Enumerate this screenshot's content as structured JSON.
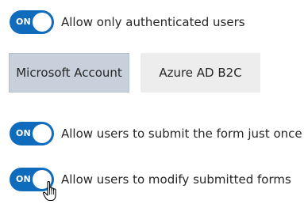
{
  "auth_setting": {
    "toggle_label": "ON",
    "label": "Allow only authenticated users",
    "enabled": true
  },
  "providers": [
    {
      "label": "Microsoft Account",
      "selected": true
    },
    {
      "label": "Azure AD B2C",
      "selected": false
    }
  ],
  "submit_once_setting": {
    "toggle_label": "ON",
    "label": "Allow users to submit the form just once",
    "enabled": true
  },
  "modify_setting": {
    "toggle_label": "ON",
    "label": "Allow users to modify submitted forms",
    "enabled": true
  },
  "colors": {
    "accent": "#0f6cbd",
    "selected_button_bg": "#c8d1db",
    "unselected_button_bg": "#ededed"
  },
  "cursor_icon": "hand-pointer-icon"
}
